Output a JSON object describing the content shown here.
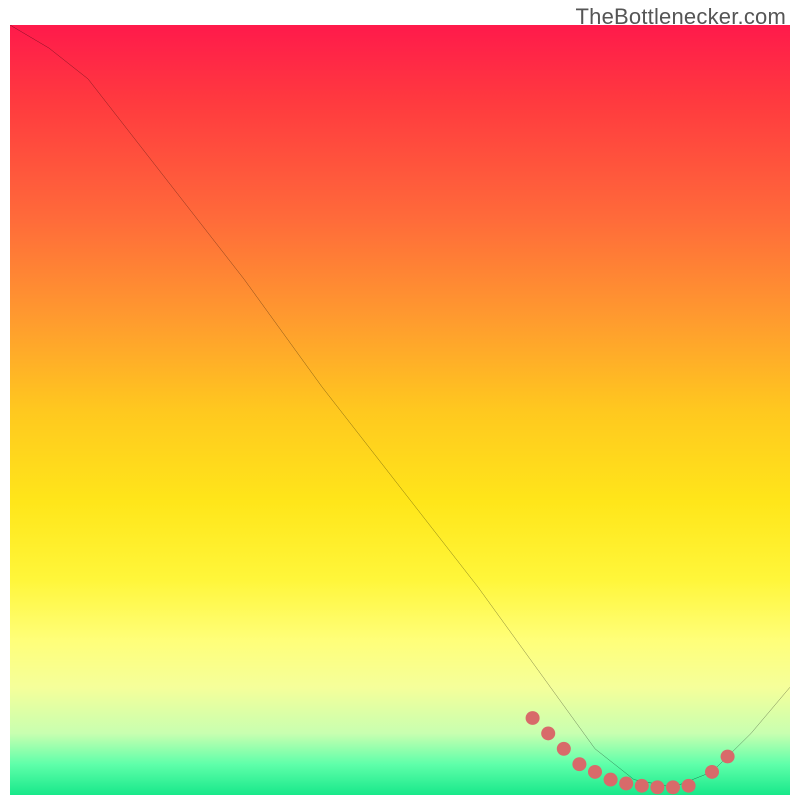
{
  "attribution": "TheBottlenecker.com",
  "chart_data": {
    "type": "line",
    "title": "",
    "xlabel": "",
    "ylabel": "",
    "xlim": [
      0,
      100
    ],
    "ylim": [
      0,
      100
    ],
    "series": [
      {
        "name": "curve",
        "x": [
          0,
          5,
          10,
          20,
          30,
          40,
          50,
          60,
          65,
          70,
          75,
          80,
          85,
          90,
          95,
          100
        ],
        "y": [
          100,
          97,
          93,
          80,
          67,
          53,
          40,
          27,
          20,
          13,
          6,
          2,
          1,
          3,
          8,
          14
        ]
      }
    ],
    "markers": {
      "name": "highlight-points",
      "color": "#d86a6a",
      "x": [
        67,
        69,
        71,
        73,
        75,
        77,
        79,
        81,
        83,
        85,
        87,
        90,
        92
      ],
      "y": [
        10,
        8,
        6,
        4,
        3,
        2,
        1.5,
        1.2,
        1,
        1,
        1.2,
        3,
        5
      ]
    }
  }
}
